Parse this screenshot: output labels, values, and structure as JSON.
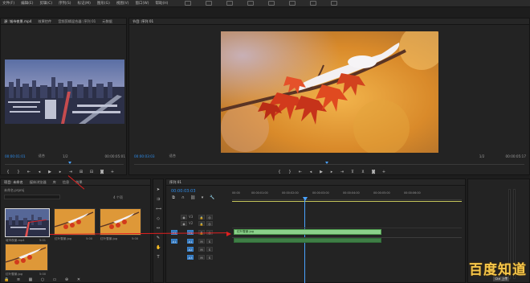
{
  "menubar": {
    "items": [
      "文件(F)",
      "编辑(E)",
      "剪辑(C)",
      "序列(S)",
      "标记(M)",
      "图形(G)",
      "视图(V)",
      "窗口(W)",
      "帮助(H)"
    ],
    "workspace_icons": [
      "ws-1-icon",
      "ws-2-icon",
      "ws-3-icon",
      "ws-4-icon",
      "ws-5-icon",
      "ws-6-icon",
      "ws-7-icon",
      "ws-8-icon"
    ]
  },
  "source_monitor": {
    "tabs": [
      "源: 城市夜景.mp4",
      "效果控件",
      "音频剪辑混合器: 序列 01",
      "元数据"
    ],
    "timecode_in": "00:00:01:01",
    "fit_label": "适合",
    "page": "1/2",
    "timecode_out": "00:00:05:01"
  },
  "program_monitor": {
    "tabs": [
      "节目: 序列 01"
    ],
    "timecode_in": "00:00:03:03",
    "fit_label": "适合",
    "page": "1/2",
    "timecode_out": "00:00:05:17"
  },
  "project_panel": {
    "tabs": [
      "项目: 未命名",
      "媒体浏览器",
      "库",
      "信息",
      "效果"
    ],
    "path": "未命名.prproj",
    "item_count": "4 个项",
    "clips": [
      {
        "name": "城市夜景.mp4",
        "duration": "5:01"
      },
      {
        "name": "红叶雪景.jpg",
        "duration": "5:00"
      },
      {
        "name": "红叶雪景.jpg",
        "duration": "5:00"
      },
      {
        "name": "红叶雪景.jpg",
        "duration": "5:00"
      }
    ]
  },
  "timeline": {
    "tab": "序列 01",
    "timecode": "00:00:03:03",
    "ruler_labels": [
      "00:00",
      "00:00:01:00",
      "00:00:02:00",
      "00:00:03:00",
      "00:00:04:00",
      "00:00:05:00",
      "00:00:06:00"
    ],
    "video_tracks": [
      "V3",
      "V2",
      "V1"
    ],
    "audio_tracks": [
      "A1",
      "A2",
      "A3"
    ],
    "clip_label": "红叶雪景.jpg",
    "audio_clip_label": ""
  },
  "watermark": {
    "text": "百度知道",
    "small": "Ctrl 上传"
  },
  "colors": {
    "accent": "#2d8ceb",
    "clip_green": "#5fbf5f",
    "arrow_red": "#e02020"
  }
}
